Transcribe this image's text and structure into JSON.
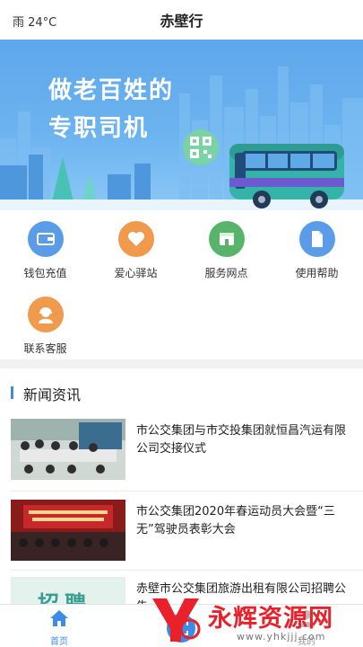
{
  "status": {
    "weather": "雨  24°C"
  },
  "header": {
    "title": "赤壁行"
  },
  "banner": {
    "line1": "做老百姓的",
    "line2": "专职司机"
  },
  "services": [
    {
      "label": "钱包充值",
      "icon": "wallet-icon",
      "color": "#5b9ce8"
    },
    {
      "label": "爱心驿站",
      "icon": "heart-icon",
      "color": "#ef9a4c"
    },
    {
      "label": "服务网点",
      "icon": "store-icon",
      "color": "#58b46b"
    },
    {
      "label": "使用帮助",
      "icon": "document-icon",
      "color": "#5b9ce8"
    },
    {
      "label": "联系客服",
      "icon": "customer-service-icon",
      "color": "#ef9a4c"
    }
  ],
  "news": {
    "heading": "新闻资讯",
    "items": [
      {
        "title": "市公交集团与市交投集团就恒昌汽运有限公司交接仪式"
      },
      {
        "title": "市公交集团2020年春运动员大会暨“三无”驾驶员表彰大会"
      },
      {
        "title": "赤壁市公交集团旅游出租有限公司招聘公告",
        "thumb_text": "招聘"
      }
    ]
  },
  "tabbar": {
    "home": "首页",
    "mine": "我的"
  },
  "watermark": {
    "text": "永辉资源网",
    "url": "www.yhkjjj.com"
  }
}
